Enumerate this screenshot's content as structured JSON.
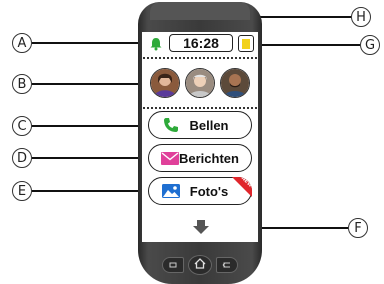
{
  "callouts": {
    "a": "A",
    "b": "B",
    "c": "C",
    "d": "D",
    "e": "E",
    "f": "F",
    "g": "G",
    "h": "H"
  },
  "status_bar": {
    "time": "16:28",
    "bell_icon": "bell-icon",
    "battery_icon": "battery-icon",
    "accent_green": "#2eaa3a",
    "battery_yellow": "#f2d21c"
  },
  "contacts": {
    "avatars": [
      "contact-avatar-1",
      "contact-avatar-2",
      "contact-avatar-3"
    ]
  },
  "actions": {
    "call_label": "Bellen",
    "messages_label": "Berichten",
    "photos_label": "Foto's",
    "new_badge": "NEW",
    "call_icon": "phone-icon",
    "messages_icon": "envelope-icon",
    "photos_icon": "photo-icon",
    "call_color": "#2eaa3a",
    "messages_color": "#e0409a",
    "photos_color": "#1f6fd1"
  },
  "navigation": {
    "down_arrow_icon": "down-arrow-icon",
    "back_icon": "back-icon",
    "home_icon": "home-icon",
    "menu_icon": "menu-icon"
  }
}
